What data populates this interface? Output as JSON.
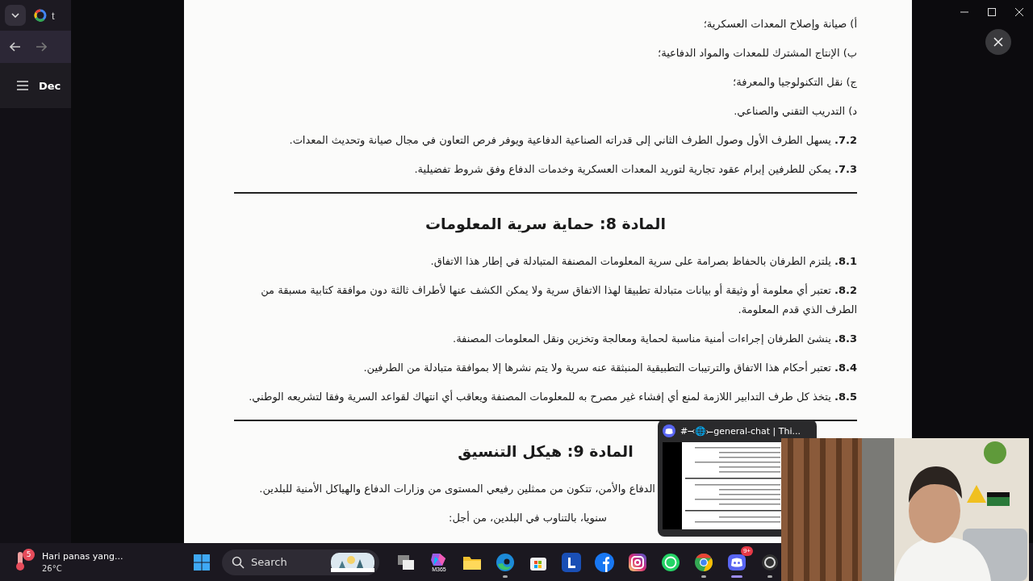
{
  "browser": {
    "tab_title": "t",
    "page_title": "Dec"
  },
  "document": {
    "rows": [
      {
        "kind": "item",
        "text": "أ) صيانة وإصلاح المعدات العسكرية؛"
      },
      {
        "kind": "item",
        "text": "ب) الإنتاج المشترك للمعدات والمواد الدفاعية؛"
      },
      {
        "kind": "item",
        "text": "ج) نقل التكنولوجيا والمعرفة؛"
      },
      {
        "kind": "item",
        "text": "د) التدريب التقني والصناعي."
      },
      {
        "kind": "item",
        "text": "**7.2.** يسهل الطرف الأول وصول الطرف الثاني إلى قدراته الصناعية الدفاعية ويوفر فرص التعاون في مجال صيانة وتحديث المعدات."
      },
      {
        "kind": "item",
        "text": "**7.3.** يمكن للطرفين إبرام عقود تجارية لتوريد المعدات العسكرية وخدمات الدفاع وفق شروط تفضيلية."
      },
      {
        "kind": "rule"
      },
      {
        "kind": "heading",
        "text": "المادة 8: حماية سرية المعلومات"
      },
      {
        "kind": "item",
        "text": "**8.1.** يلتزم الطرفان بالحفاظ بصرامة على سرية المعلومات المصنفة المتبادلة في إطار هذا الاتفاق."
      },
      {
        "kind": "item",
        "text": "**8.2.** تعتبر أي معلومة أو وثيقة أو بيانات متبادلة تطبيقا لهذا الاتفاق سرية ولا يمكن الكشف عنها لأطراف ثالثة دون موافقة كتابية مسبقة من الطرف الذي قدم المعلومة."
      },
      {
        "kind": "item",
        "text": "**8.3.** ينشئ الطرفان إجراءات أمنية مناسبة لحماية ومعالجة وتخزين ونقل المعلومات المصنفة."
      },
      {
        "kind": "item",
        "text": "**8.4.** تعتبر أحكام هذا الاتفاق والترتيبات التطبيقية المنبثقة عنه سرية ولا يتم نشرها إلا بموافقة متبادلة من الطرفين."
      },
      {
        "kind": "item",
        "text": "**8.5.** يتخذ كل طرف التدابير اللازمة لمنع أي إفشاء غير مصرح به للمعلومات المصنفة ويعاقب أي انتهاك لقواعد السرية وفقا لتشريعه الوطني."
      },
      {
        "kind": "rule"
      },
      {
        "kind": "heading",
        "text": "المادة 9: هيكل التنسيق"
      },
      {
        "kind": "partial",
        "text": "الدفاع والأمن، تتكون من ممثلين رفيعي المستوى من وزارات الدفاع والهياكل الأمنية للبلدين."
      },
      {
        "kind": "partial",
        "text": "سنويا، بالتناوب في البلدين، من أجل:"
      }
    ]
  },
  "preview": {
    "title": "#⤙🌐⤚general-chat | Thi..."
  },
  "taskbar": {
    "weather_badge": "5",
    "weather_title": "Hari panas yang...",
    "temperature": "26°C",
    "search": "Search",
    "apps": [
      {
        "kind": "taskview",
        "running": false
      },
      {
        "kind": "m365",
        "label": "M365",
        "running": false
      },
      {
        "kind": "explorer",
        "running": false
      },
      {
        "kind": "edge",
        "running": true
      },
      {
        "kind": "store",
        "running": false
      },
      {
        "kind": "letter",
        "running": false
      },
      {
        "kind": "facebook",
        "running": false
      },
      {
        "kind": "instagram",
        "running": false
      },
      {
        "kind": "whatsapp",
        "running": false
      },
      {
        "kind": "chrome",
        "running": true
      },
      {
        "kind": "discord",
        "badge": "9+",
        "running": true
      },
      {
        "kind": "camera",
        "running": true
      }
    ]
  }
}
